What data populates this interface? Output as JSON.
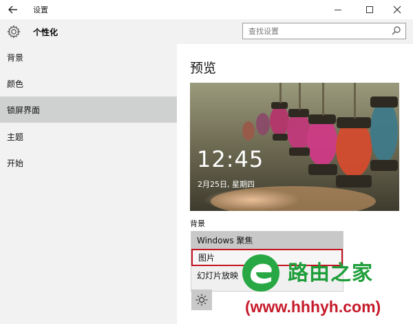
{
  "window": {
    "back_icon": "back-arrow-icon",
    "title": "设置",
    "min_icon": "minimize-icon",
    "max_icon": "maximize-icon",
    "close_icon": "close-icon"
  },
  "sidebar": {
    "header_icon": "gear-icon",
    "section_title": "个性化",
    "items": [
      {
        "label": "背景",
        "selected": false
      },
      {
        "label": "颜色",
        "selected": false
      },
      {
        "label": "锁屏界面",
        "selected": true
      },
      {
        "label": "主题",
        "selected": false
      },
      {
        "label": "开始",
        "selected": false
      }
    ]
  },
  "search": {
    "placeholder": "查找设置",
    "icon": "search-icon"
  },
  "main": {
    "title": "预览",
    "preview": {
      "time": "12:45",
      "date": "2月25日, 星期四"
    },
    "background_label": "背景",
    "dropdown": {
      "options": [
        {
          "label": "Windows 聚焦",
          "state": "hover"
        },
        {
          "label": "图片",
          "state": "selected"
        },
        {
          "label": "幻灯片放映",
          "state": "normal"
        }
      ]
    },
    "brightness_icon": "brightness-icon"
  },
  "watermark": {
    "title": "路由之家",
    "url": "(www.hhhyh.com)"
  },
  "colors": {
    "sidebar_bg": "#f2f2f2",
    "selected_bg": "#cfd0d0",
    "highlight_border": "#c4121f",
    "watermark_green": "#1e9e3a",
    "watermark_red": "#c61a2a"
  }
}
